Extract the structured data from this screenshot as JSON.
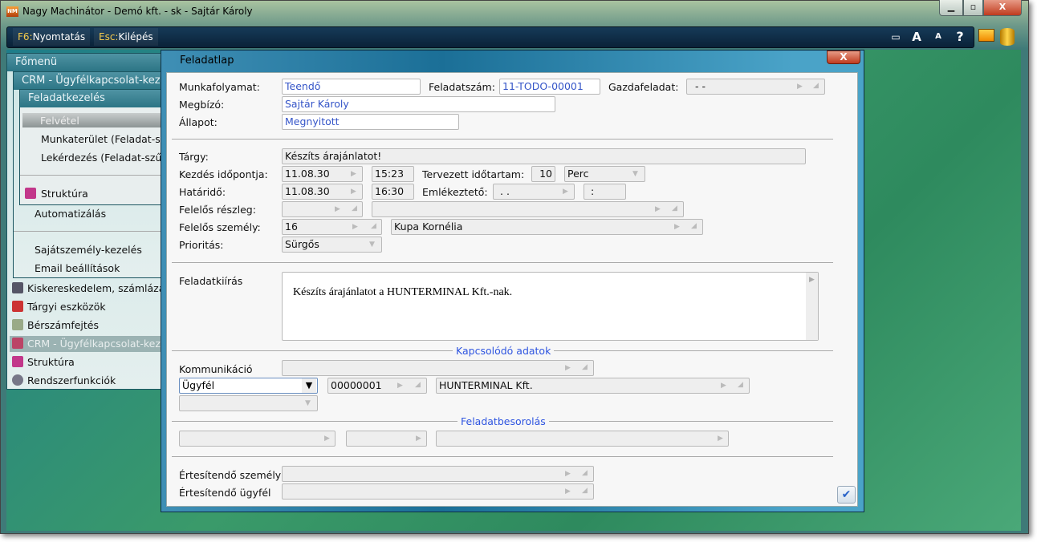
{
  "window": {
    "title": "Nagy Machinátor - Demó kft. - sk - Sajtár Károly",
    "logo": "NM"
  },
  "toolbar": {
    "print_key": "F6:",
    "print_label": "Nyomtatás",
    "exit_key": "Esc:",
    "exit_label": "Kilépés",
    "icons": [
      "window-icon",
      "font-larger-icon",
      "font-smaller-icon",
      "help-icon",
      "monitor-icon",
      "database-icon"
    ],
    "big_a": "A",
    "small_a": "A",
    "help": "?"
  },
  "menu": {
    "main_title": "Főmenü",
    "crm_title": "CRM - Ügyfélkapcsolat-kez",
    "task_title": "Feladatkezelés",
    "task_items": [
      "Felvétel",
      "Munkaterület (Feladat-sz",
      "Lekérdezés (Feladat-szűr",
      "Struktúra"
    ],
    "crm_items": [
      "Automatizálás",
      "Sajátszemély-kezelés",
      "Email beállítások"
    ],
    "main_items": [
      "Kiskereskedelem, számlázás",
      "Tárgyi eszközök",
      "Bérszámfejtés",
      "CRM - Ügyfélkapcsolat-kez",
      "Struktúra",
      "Rendszerfunkciók"
    ]
  },
  "dialog": {
    "title": "Feladatlap",
    "close": "X",
    "labels": {
      "workflow": "Munkafolyamat:",
      "task_no": "Feladatszám:",
      "parent": "Gazdafeladat:",
      "client": "Megbízó:",
      "state": "Állapot:",
      "subject": "Tárgy:",
      "start": "Kezdés időpontja:",
      "planned": "Tervezett időtartam:",
      "deadline": "Határidő:",
      "reminder": "Emlékeztető:",
      "dept": "Felelős részleg:",
      "person": "Felelős személy:",
      "priority": "Prioritás:",
      "description": "Feladatkiírás",
      "communication": "Kommunikáció",
      "notify_person": "Értesítendő személy",
      "notify_customer": "Értesítendő ügyfél"
    },
    "values": {
      "workflow": "Teendő",
      "task_no": "11-TODO-00001",
      "parent": "-   -",
      "client": "Sajtár Károly",
      "state": "Megnyitott",
      "subject": "Készíts árajánlatot!",
      "start_date": "11.08.30",
      "start_time": "15:23",
      "duration": "10",
      "duration_unit": "Perc",
      "deadline_date": "11.08.30",
      "deadline_time": "16:30",
      "reminder_date": " . .",
      "reminder_time": ":",
      "dept_code": "",
      "dept_name": "",
      "person_code": "16",
      "person_name": "Kupa Kornélia",
      "priority": "Sürgős",
      "description": "Készíts árajánlatot a HUNTERMINAL Kft.-nak.",
      "communication": "",
      "partner_type": "Ügyfél",
      "partner_code": "00000001",
      "partner_name": "HUNTERMINAL Kft."
    },
    "sections": {
      "related": "Kapcsolódó adatok",
      "classification": "Feladatbesorolás"
    }
  }
}
